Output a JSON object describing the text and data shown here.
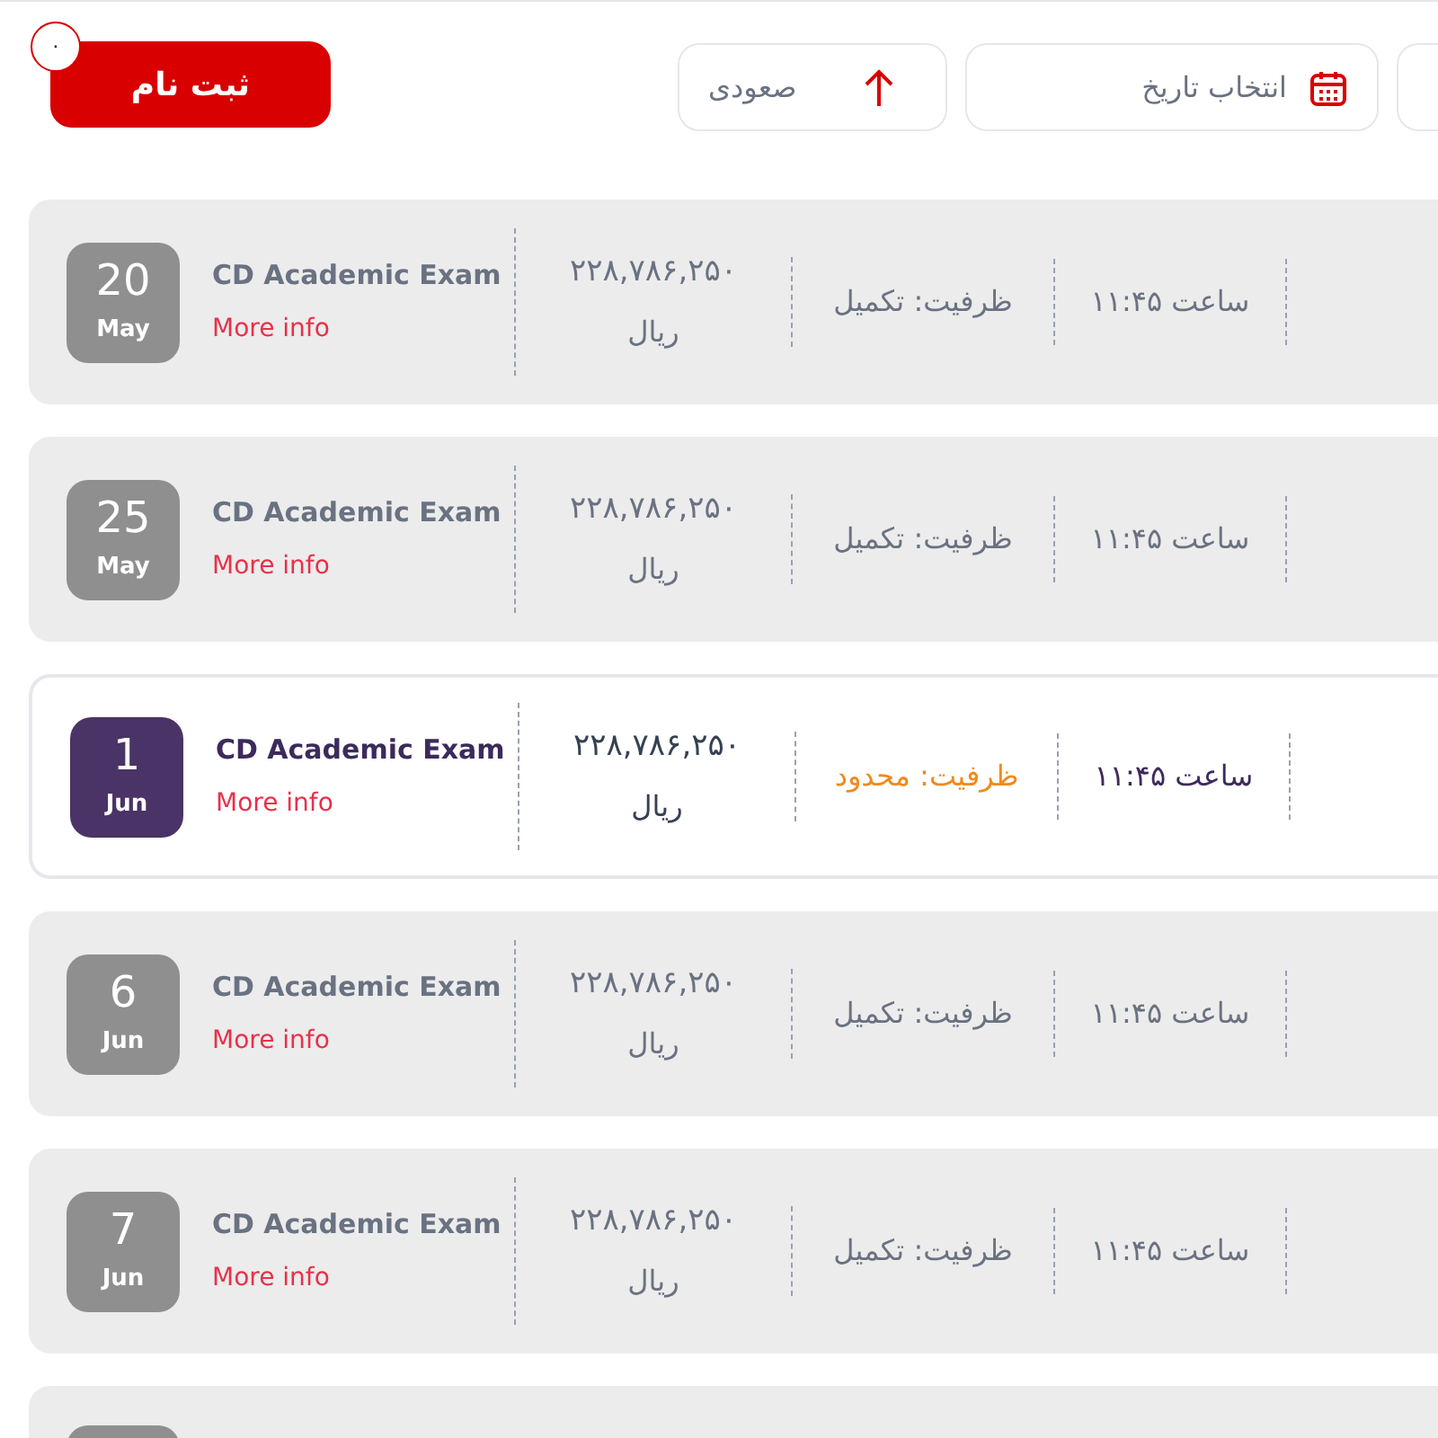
{
  "register_button": {
    "label": "ثبت نام",
    "badge": "۰"
  },
  "filters": [
    {
      "kind": "cut"
    },
    {
      "kind": "date",
      "label": "انتخاب تاریخ"
    },
    {
      "kind": "sort",
      "label": "صعودی"
    }
  ],
  "exams": [
    {
      "day": "20",
      "month": "May",
      "title": "CD Academic Exam",
      "link": "More info",
      "price": "۲۲۸,۷۸۶,۲۵۰",
      "currency": "ریال",
      "capacity": "ظرفیت: تکمیل",
      "time": "ساعت ۱۱:۴۵",
      "disabled": true
    },
    {
      "day": "25",
      "month": "May",
      "title": "CD Academic Exam",
      "link": "More info",
      "price": "۲۲۸,۷۸۶,۲۵۰",
      "currency": "ریال",
      "capacity": "ظرفیت: تکمیل",
      "time": "ساعت ۱۱:۴۵",
      "disabled": true
    },
    {
      "day": "1",
      "month": "Jun",
      "title": "CD Academic Exam",
      "link": "More info",
      "price": "۲۲۸,۷۸۶,۲۵۰",
      "currency": "ریال",
      "capacity": "ظرفیت: محدود",
      "time": "ساعت ۱۱:۴۵",
      "disabled": false
    },
    {
      "day": "6",
      "month": "Jun",
      "title": "CD Academic Exam",
      "link": "More info",
      "price": "۲۲۸,۷۸۶,۲۵۰",
      "currency": "ریال",
      "capacity": "ظرفیت: تکمیل",
      "time": "ساعت ۱۱:۴۵",
      "disabled": true
    },
    {
      "day": "7",
      "month": "Jun",
      "title": "CD Academic Exam",
      "link": "More info",
      "price": "۲۲۸,۷۸۶,۲۵۰",
      "currency": "ریال",
      "capacity": "ظرفیت: تکمیل",
      "time": "ساعت ۱۱:۴۵",
      "disabled": true
    },
    {
      "disabled": true
    }
  ]
}
